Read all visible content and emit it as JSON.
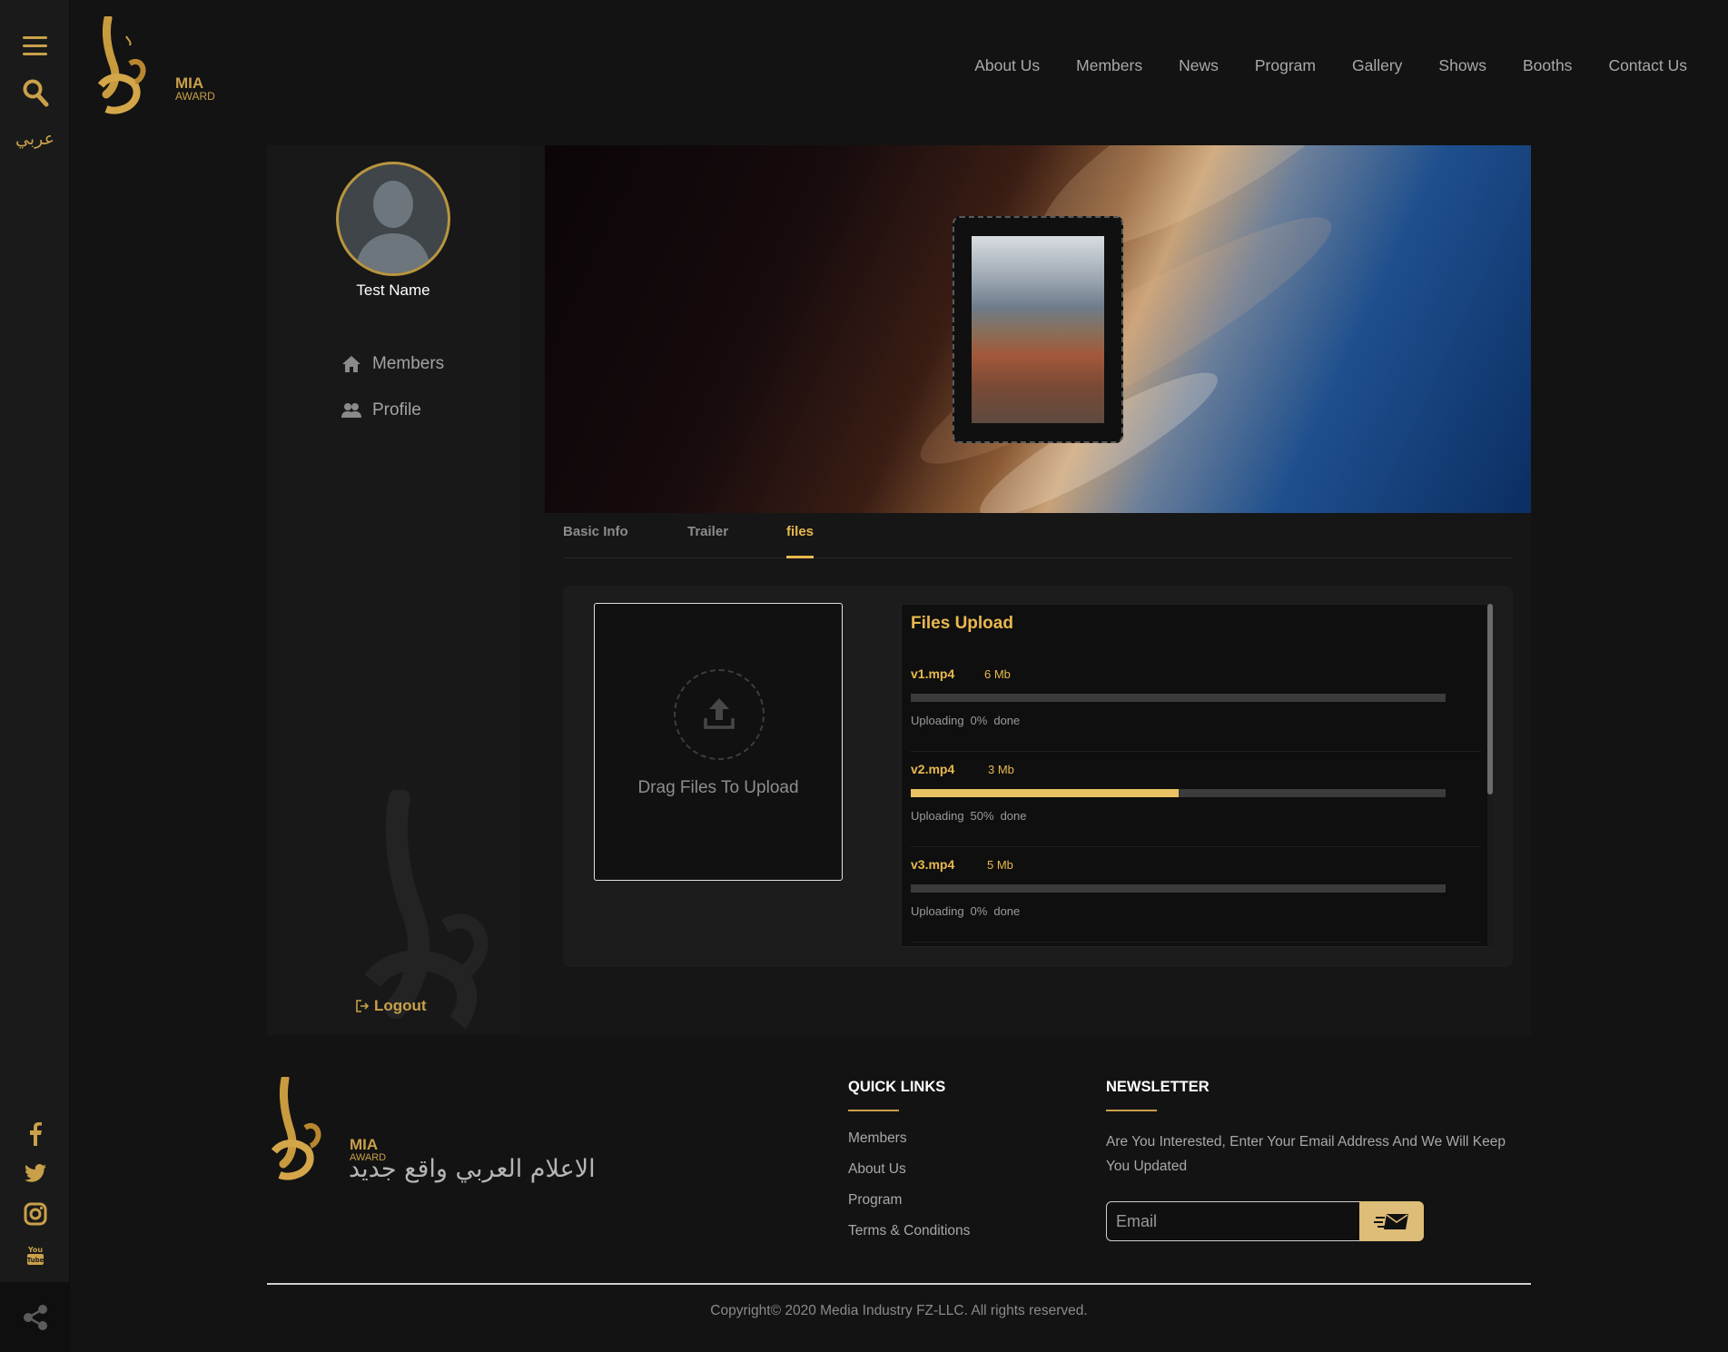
{
  "rail": {
    "menu_icon": "hamburger-icon",
    "search_icon": "search-icon",
    "lang_label": "عربي",
    "share_icon": "share-icon",
    "social": [
      {
        "name": "facebook-icon"
      },
      {
        "name": "twitter-icon"
      },
      {
        "name": "instagram-icon"
      },
      {
        "name": "youtube-icon"
      }
    ]
  },
  "brand": {
    "name": "MIA",
    "sub": "AWARD",
    "accent": "#c9a04a"
  },
  "nav": {
    "items": [
      "About Us",
      "Members",
      "News",
      "Program",
      "Gallery",
      "Shows",
      "Booths",
      "Contact Us"
    ]
  },
  "sidebar": {
    "user_name": "Test Name",
    "items": [
      {
        "label": "Members",
        "icon": "home-icon"
      },
      {
        "label": "Profile",
        "icon": "users-icon"
      }
    ],
    "logout": "Logout"
  },
  "tabs": [
    {
      "label": "Basic Info",
      "active": false
    },
    {
      "label": "Trailer",
      "active": false
    },
    {
      "label": "files",
      "active": true
    }
  ],
  "upload": {
    "drop_label": "Drag Files To Upload",
    "title": "Files Upload",
    "files": [
      {
        "name": "v1.mp4",
        "size": "6 Mb",
        "status": "Uploading",
        "percent_label": "0%",
        "done": "done",
        "progress": 0
      },
      {
        "name": "v2.mp4",
        "size": "3 Mb",
        "status": "Uploading",
        "percent_label": "50%",
        "done": "done",
        "progress": 0.5
      },
      {
        "name": "v3.mp4",
        "size": "5 Mb",
        "status": "Uploading",
        "percent_label": "0%",
        "done": "done",
        "progress": 0
      }
    ]
  },
  "footer": {
    "brand_name": "MIA",
    "brand_sub": "AWARD",
    "slogan": "الاعلام العربي واقع جديد",
    "quick_links_title": "QUICK LINKS",
    "quick_links": [
      "Members",
      "About Us",
      "Program",
      "Terms & Conditions"
    ],
    "newsletter_title": "NEWSLETTER",
    "newsletter_text": "Are You Interested, Enter Your Email Address And We Will Keep You Updated",
    "email_placeholder": "Email",
    "copyright": "Copyright© 2020 Media Industry FZ-LLC. All rights reserved."
  },
  "colors": {
    "accent": "#e9b94e",
    "bg": "#131313"
  }
}
